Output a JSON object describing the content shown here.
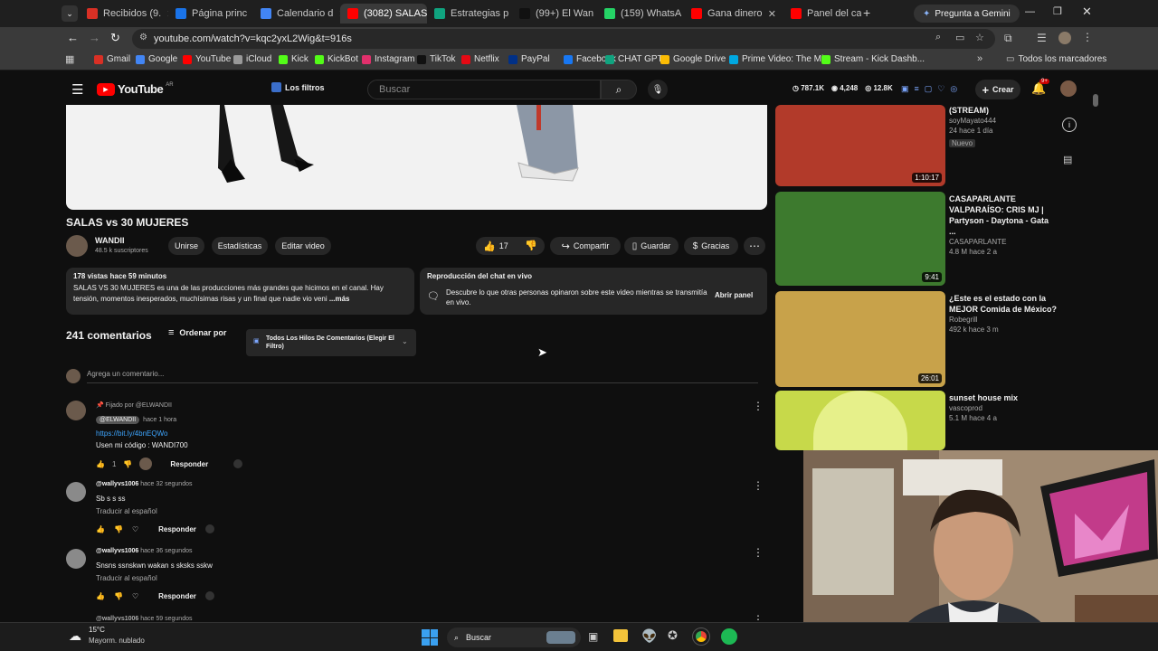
{
  "browser": {
    "tabs": [
      {
        "label": "Recibidos (9.",
        "color": "#d93025",
        "active": false
      },
      {
        "label": "Página princ",
        "color": "#1a73e8",
        "active": false
      },
      {
        "label": "Calendario d",
        "color": "#4285f4",
        "active": false
      },
      {
        "label": "(3082) SALAS",
        "color": "#ff0000",
        "active": true
      },
      {
        "label": "Estrategias p",
        "color": "#10a37f",
        "active": false
      },
      {
        "label": "(99+) El Wan",
        "color": "#111111",
        "active": false
      },
      {
        "label": "(159) WhatsA",
        "color": "#25d366",
        "active": false
      },
      {
        "label": "Gana dinero",
        "color": "#ff0000",
        "active": false
      },
      {
        "label": "Panel del can",
        "color": "#ff0000",
        "active": false
      }
    ],
    "gemini": "Pregunta a Gemini",
    "url": "youtube.com/watch?v=kqc2yxL2Wig&t=916s",
    "bookmarks": [
      {
        "label": "Gmail",
        "color": "#d93025"
      },
      {
        "label": "Google",
        "color": "#4285f4"
      },
      {
        "label": "YouTube",
        "color": "#ff0000"
      },
      {
        "label": "iCloud",
        "color": "#999999"
      },
      {
        "label": "Kick",
        "color": "#53fc18"
      },
      {
        "label": "KickBot",
        "color": "#53fc18"
      },
      {
        "label": "Instagram",
        "color": "#e1306c"
      },
      {
        "label": "TikTok",
        "color": "#111111"
      },
      {
        "label": "Netflix",
        "color": "#e50914"
      },
      {
        "label": "PayPal",
        "color": "#003087"
      },
      {
        "label": "Facebook",
        "color": "#1877f2"
      },
      {
        "label": "CHAT GPT",
        "color": "#10a37f"
      },
      {
        "label": "Google Drive",
        "color": "#fbbc04"
      },
      {
        "label": "Prime Video: The Mi...",
        "color": "#00a8e1"
      },
      {
        "label": "Stream - Kick Dashb...",
        "color": "#53fc18"
      }
    ],
    "all_bookmarks": "Todos los marcadores"
  },
  "youtube": {
    "logo": "YouTube",
    "region": "AR",
    "filters": "Los filtros",
    "search_placeholder": "Buscar",
    "stats": {
      "subs": "787.1K",
      "watching": "4,248",
      "views": "12.8K"
    },
    "create": "Crear",
    "notif_badge": "9+"
  },
  "video": {
    "title": "SALAS vs 30 MUJERES",
    "channel": "WANDII",
    "subs": "48.5 k suscriptores",
    "buttons": {
      "join": "Unirse",
      "stats": "Estadísticas",
      "edit": "Editar video"
    },
    "likes": "17",
    "share": "Compartir",
    "save": "Guardar",
    "thanks": "Gracias",
    "desc_meta": "178 vistas  hace 59 minutos",
    "desc_text": "SALAS VS 30 MUJERES es una de las producciones más grandes que hicimos en el canal. Hay tensión, momentos inesperados, muchísimas risas y un final que nadie vio veni",
    "desc_more": "...más",
    "chat_title": "Reproducción del chat en vivo",
    "chat_text": "Descubre lo que otras personas opinaron sobre este video mientras se transmitía en vivo.",
    "chat_button": "Abrir panel"
  },
  "comments": {
    "count": "241 comentarios",
    "sort": "Ordenar por",
    "filter": "Todos Los Hilos De Comentarios (Elegir El Filtro)",
    "add": "Agrega un comentario...",
    "pinned": "Fijado por @ELWANDII",
    "items": [
      {
        "author": "@ELWANDII",
        "time": "hace 1 hora",
        "link": "https://bit.ly/4bnEQWo",
        "text": "Usen mi código : WANDI700",
        "likes": "1",
        "reply": "Responder"
      },
      {
        "author": "@wallyvs1006",
        "time": "hace 32 segundos",
        "text": "Sb s s ss",
        "translate": "Traducir al español",
        "reply": "Responder"
      },
      {
        "author": "@wallyvs1006",
        "time": "hace 36 segundos",
        "text": "Snsns  ssnskwn wakan s sksks sskw",
        "translate": "Traducir al español",
        "reply": "Responder"
      },
      {
        "author": "@wallyvs1006",
        "time": "hace 59 segundos"
      }
    ]
  },
  "related": [
    {
      "title": "(STREAM)",
      "channel": "soyMayato444",
      "meta": "24  hace 1 día",
      "badge": "Nuevo",
      "duration": "1:10:17",
      "thumb_color": "#b23a2a"
    },
    {
      "title": "CASAPARLANTE VALPARAÍSO: CRIS MJ | Partyson - Daytona - Gata ...",
      "channel": "CASAPARLANTE",
      "meta": "4.8 M  hace 2 a",
      "duration": "9:41",
      "thumb_color": "#3d7a2e"
    },
    {
      "title": "¿Este es el estado con la MEJOR Comida de México?",
      "channel": "Robegrill",
      "meta": "492 k  hace 3 m",
      "duration": "26:01",
      "thumb_color": "#c8a24a"
    },
    {
      "title": "sunset house mix",
      "channel": "vascoprod",
      "meta": "5.1 M  hace 4 a",
      "thumb_color": "#c7d94a"
    }
  ],
  "taskbar": {
    "temp": "15°C",
    "weather": "Mayorm. nublado",
    "search": "Buscar"
  }
}
